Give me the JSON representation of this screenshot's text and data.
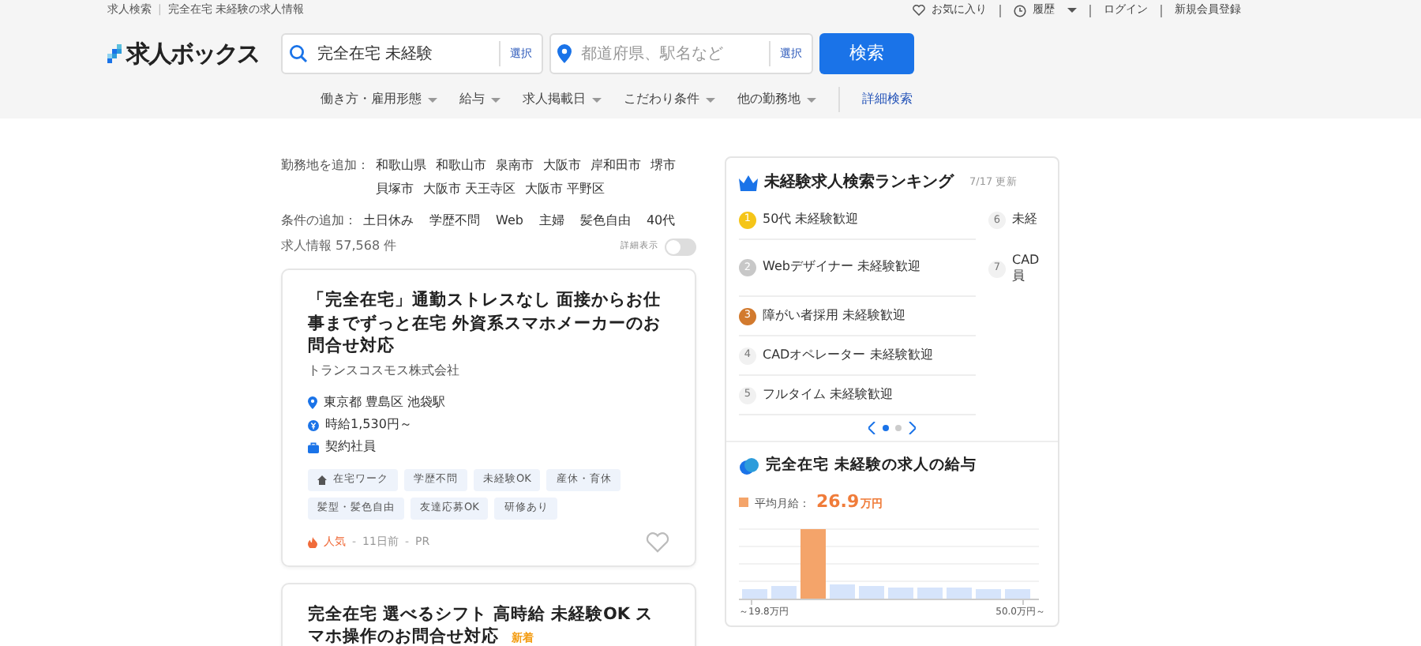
{
  "breadcrumb": {
    "home": "求人検索",
    "current": "完全在宅 未経験の求人情報",
    "separator": "|"
  },
  "top_links": [
    {
      "kind": "heart",
      "label": "お気に入り",
      "caret": false
    },
    {
      "kind": "clock",
      "label": "履歴",
      "caret": true
    },
    {
      "kind": "plain",
      "label": "ログイン",
      "caret": false
    },
    {
      "kind": "plain",
      "label": "新規会員登録",
      "caret": false
    }
  ],
  "logo": "求人ボックス",
  "keyword_field": {
    "value": "完全在宅 未経験",
    "select": "選択"
  },
  "location_field": {
    "placeholder": "都道府県、駅名など",
    "select": "選択"
  },
  "search_button": "検索",
  "filters": [
    {
      "label": "働き方・雇用形態",
      "caret": true
    },
    {
      "label": "給与",
      "caret": true
    },
    {
      "label": "求人掲載日",
      "caret": true
    },
    {
      "label": "こだわり条件",
      "caret": true
    },
    {
      "label": "他の勤務地",
      "caret": true
    },
    {
      "label": "詳細検索",
      "caret": false
    }
  ],
  "add_location": {
    "label": "勤務地を追加：",
    "links": [
      "和歌山県",
      "和歌山市",
      "泉南市",
      "大阪市",
      "岸和田市",
      "堺市",
      "貝塚市",
      "大阪市 天王寺区",
      "大阪市 平野区"
    ]
  },
  "add_condition": {
    "label": "条件の追加：",
    "links": [
      "土日休み",
      "学歴不問",
      "Web",
      "主婦",
      "髪色自由",
      "40代"
    ]
  },
  "result_count": "求人情報 57,568 件",
  "detail_toggle": {
    "label": "詳細表示",
    "on": false
  },
  "jobs": [
    {
      "title": "「完全在宅」通勤ストレスなし 面接からお仕事までずっと在宅 外資系スマホメーカーのお問合せ対応",
      "new": false,
      "company": "トランスコスモス株式会社",
      "location": "東京都 豊島区 池袋駅",
      "salary": "時給1,530円～",
      "employment": "契約社員",
      "tags": [
        {
          "label": "在宅ワーク",
          "icon": true
        },
        {
          "label": "学歴不問",
          "icon": false
        },
        {
          "label": "未経験OK",
          "icon": false
        },
        {
          "label": "産休・育休",
          "icon": false
        },
        {
          "label": "髪型・髪色自由",
          "icon": false
        },
        {
          "label": "友達応募OK",
          "icon": false
        },
        {
          "label": "研修あり",
          "icon": false
        }
      ],
      "popular": "人気",
      "separator": "-",
      "age": "11日前",
      "pr": "PR",
      "favorite": false
    },
    {
      "title": "完全在宅 選べるシフト 高時給 未経験OK スマホ操作のお問合せ対応",
      "new": true,
      "new_label": "新着"
    }
  ],
  "ranking": {
    "title": "未経験求人検索ランキング",
    "updated": "7/17 更新",
    "pages": [
      [
        {
          "rank": "1",
          "kind": "medal",
          "color": "#f5c518",
          "lines": [
            "50代 未経験歓迎"
          ]
        },
        {
          "rank": "2",
          "kind": "medal",
          "color": "#c8c8c8",
          "lines": [
            "Webデザイナー 未経験歓迎"
          ]
        },
        {
          "rank": "3",
          "kind": "medal",
          "color": "#d27a2e",
          "lines": [
            "障がい者採用 未経験歓迎"
          ]
        },
        {
          "rank": "4",
          "kind": "plain",
          "color": "#f1f1f1",
          "lines": [
            "CADオペレーター 未経験歓迎"
          ]
        },
        {
          "rank": "5",
          "kind": "plain",
          "color": "#f1f1f1",
          "lines": [
            "フルタイム 未経験歓迎"
          ]
        }
      ],
      [
        {
          "rank": "6",
          "kind": "plain",
          "color": "#f1f1f1",
          "lines": [
            "未経"
          ]
        },
        {
          "rank": "7",
          "kind": "plain",
          "color": "#f1f1f1",
          "lines": [
            "CAD",
            "員"
          ]
        }
      ]
    ],
    "dots": [
      {
        "selected": true
      },
      {
        "selected": false
      }
    ]
  },
  "salary": {
    "title": "完全在宅 未経験の求人の給与",
    "avg_label": "平均月給：",
    "avg_value": "26.9",
    "avg_unit": "万円",
    "axis_min": "～19.8万円",
    "axis_max": "50.0万円～"
  }
}
